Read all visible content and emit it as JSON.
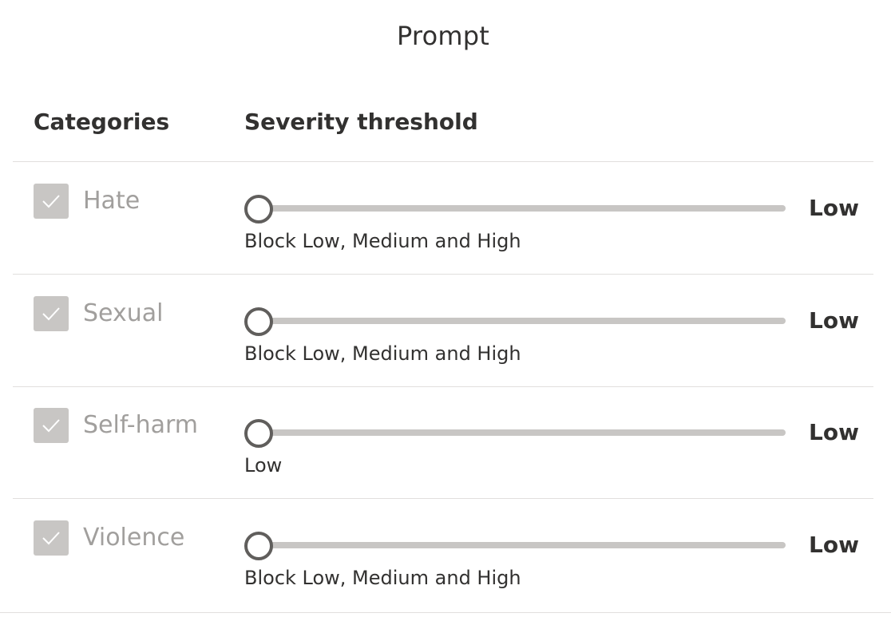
{
  "panel": {
    "title": "Prompt",
    "columns": {
      "categories": "Categories",
      "severity": "Severity threshold"
    }
  },
  "rows": [
    {
      "category": "Hate",
      "checked": true,
      "level": "Low",
      "level_fraction": 0,
      "description": "Block Low, Medium and High"
    },
    {
      "category": "Sexual",
      "checked": true,
      "level": "Low",
      "level_fraction": 0,
      "description": "Block Low, Medium and High"
    },
    {
      "category": "Self-harm",
      "checked": true,
      "level": "Low",
      "level_fraction": 0,
      "description": "Low"
    },
    {
      "category": "Violence",
      "checked": true,
      "level": "Low",
      "level_fraction": 0,
      "description": "Block Low, Medium and High"
    }
  ],
  "colors": {
    "checkbox_disabled": "#c8c6c4",
    "track": "#c8c6c4",
    "thumb_border": "#605e5c",
    "label_disabled": "#a19f9d",
    "text": "#323130"
  },
  "icons": {
    "checkbox_mark": "checkmark-icon"
  }
}
